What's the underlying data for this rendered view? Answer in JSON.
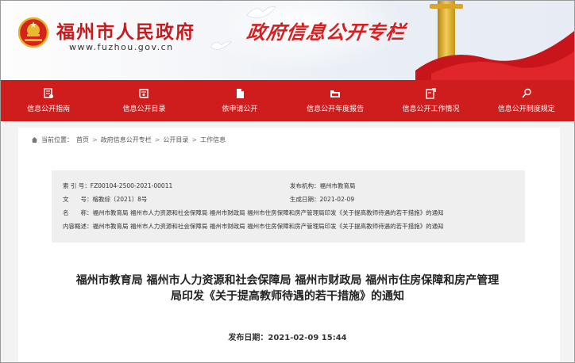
{
  "header": {
    "site_name": "福州市人民政府",
    "site_url": "www.fuzhou.gov.cn",
    "section_title": "政府信息公开专栏"
  },
  "nav": {
    "items": [
      {
        "label": "信息公开指南",
        "icon": "guide-icon"
      },
      {
        "label": "信息公开目录",
        "icon": "catalog-icon"
      },
      {
        "label": "依申请公开",
        "icon": "document-icon"
      },
      {
        "label": "信息公开年度报告",
        "icon": "folder-icon"
      },
      {
        "label": "信息公开工作情况",
        "icon": "work-icon"
      },
      {
        "label": "信息公开制度规定",
        "icon": "search-icon"
      }
    ]
  },
  "breadcrumb": {
    "prefix": "当前位置：",
    "items": [
      "首页",
      "政府信息公开专栏",
      "公开目录",
      "工作信息"
    ],
    "separator": ">"
  },
  "meta": {
    "index_label": "索 引 号：",
    "index_value": "FZ00104-2500-2021-00011",
    "org_label": "发布机构：",
    "org_value": "福州市教育局",
    "doc_no_label": "文　　号：",
    "doc_no_value": "榕教综〔2021〕8号",
    "date_label": "生成日期：",
    "date_value": "2021-02-09",
    "name_label": "名　　称：",
    "name_value": "福州市教育局 福州市人力资源和社会保障局 福州市财政局 福州市住房保障和房产管理局印发《关于提高教师待遇的若干措施》的通知",
    "summary_label": "内容概述：",
    "summary_value": "福州市教育局 福州市人力资源和社会保障局 福州市财政局 福州市住房保障和房产管理局印发《关于提高教师待遇的若干措施》的通知"
  },
  "article": {
    "title_line1": "福州市教育局 福州市人力资源和社会保障局 福州市财政局 福州市住房保障和房产管理",
    "title_line2": "局印发《关于提高教师待遇的若干措施》的通知",
    "pub_date_label": "发布日期：",
    "pub_date_value": "2021-02-09 15:44"
  },
  "colors": {
    "brand_red": "#cf1d1d",
    "meta_bg": "#efefef"
  }
}
